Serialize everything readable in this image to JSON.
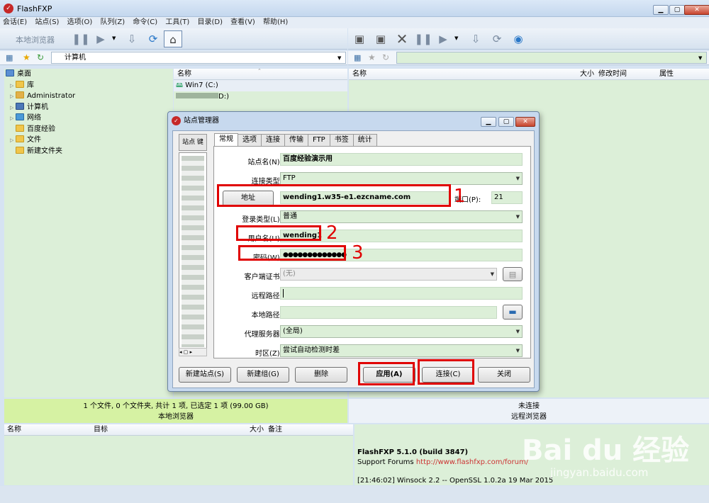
{
  "app": {
    "title": "FlashFXP"
  },
  "menu": [
    "会话(E)",
    "站点(S)",
    "选项(O)",
    "队列(Z)",
    "命令(C)",
    "工具(T)",
    "目录(D)",
    "查看(V)",
    "帮助(H)"
  ],
  "left_toolbar": {
    "mode_label": "本地浏览器"
  },
  "left_address": {
    "path": "计算机"
  },
  "left_list": {
    "col_name": "名称",
    "drives": [
      "Win7 (C:)",
      "D:)"
    ]
  },
  "tree": [
    "桌面",
    "库",
    "Administrator",
    "计算机",
    "网络",
    "百度经验",
    "文件",
    "新建文件夹"
  ],
  "right_list": {
    "col_name": "名称",
    "col_size": "大小",
    "col_modified": "修改时间",
    "col_attr": "属性"
  },
  "status_left": {
    "line1": "1 个文件, 0 个文件夹, 共计 1 项, 已选定 1 项 (99.00 GB)",
    "line2": "本地浏览器"
  },
  "status_right": {
    "line1": "未连接",
    "line2": "远程浏览器"
  },
  "queue": {
    "col_name": "名称",
    "col_target": "目标",
    "col_size": "大小",
    "col_note": "备注"
  },
  "log": {
    "line1": "FlashFXP 5.1.0 (build 3847)",
    "support_label": "Support Forums",
    "support_url": "http://www.flashfxp.com/forum/",
    "line3": "[21:46:02]  Winsock 2.2 -- OpenSSL 1.0.2a 19 Mar 2015"
  },
  "dialog": {
    "title": "站点管理器",
    "side_tab": "站点 键",
    "tabs": [
      "常规",
      "选项",
      "连接",
      "传输",
      "FTP",
      "书签",
      "统计"
    ],
    "site_name_label": "站点名(N):",
    "site_name": "百度经验演示用",
    "conn_type_label": "连接类型:",
    "conn_type": "FTP",
    "address_button": "地址",
    "address": "wending1.w35-e1.ezcname.com",
    "port_label": "端口(P):",
    "port": "21",
    "login_type_label": "登录类型(L):",
    "login_type": "普通",
    "username_label": "用户名(U):",
    "username": "wending1",
    "password_label": "密码(W):",
    "password": "●●●●●●●●●●●●●",
    "cert_label": "客户端证书:",
    "cert": "(无)",
    "remote_path_label": "远程路径:",
    "local_path_label": "本地路径:",
    "proxy_label": "代理服务器:",
    "proxy": "(全局)",
    "timezone_label": "时区(Z):",
    "timezone": "尝试自动检测时差",
    "buttons": {
      "new_site": "新建站点(S)",
      "new_group": "新建组(G)",
      "delete": "删除",
      "apply": "应用(A)",
      "connect": "连接(C)",
      "close": "关闭"
    }
  },
  "annotations": [
    "1",
    "2",
    "3"
  ],
  "watermark": {
    "brand": "Bai du 经验",
    "url": "jingyan.baidu.com"
  }
}
